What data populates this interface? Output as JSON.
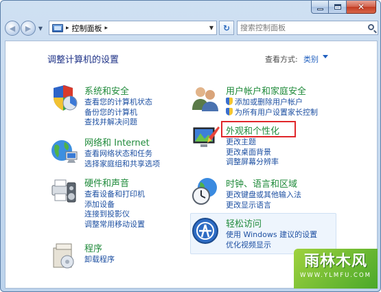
{
  "window": {
    "caption": {
      "minimize": "—",
      "maximize": "□",
      "close": "✕"
    }
  },
  "nav": {
    "back_icon": "back-arrow-icon",
    "forward_icon": "forward-arrow-icon",
    "address": {
      "separator": "▸",
      "location": "控制面板",
      "trail_separator": "▸"
    },
    "refresh_icon": "refresh-icon",
    "search": {
      "placeholder": "搜索控制面板"
    }
  },
  "page": {
    "title": "调整计算机的设置",
    "view_by_label": "查看方式:",
    "view_by_value": "类别"
  },
  "categories": {
    "system": {
      "title": "系统和安全",
      "links": [
        "查看您的计算机状态",
        "备份您的计算机",
        "查找并解决问题"
      ]
    },
    "network": {
      "title": "网络和 Internet",
      "links": [
        "查看网络状态和任务",
        "选择家庭组和共享选项"
      ]
    },
    "hardware": {
      "title": "硬件和声音",
      "links": [
        "查看设备和打印机",
        "添加设备",
        "连接到投影仪",
        "调整常用移动设置"
      ]
    },
    "programs": {
      "title": "程序",
      "links": [
        "卸载程序"
      ]
    },
    "users": {
      "title": "用户帐户和家庭安全",
      "links": [
        "添加或删除用户帐户",
        "为所有用户设置家长控制"
      ]
    },
    "appearance": {
      "title": "外观和个性化",
      "links": [
        "更改主题",
        "更改桌面背景",
        "调整屏幕分辨率"
      ]
    },
    "clock": {
      "title": "时钟、语言和区域",
      "links": [
        "更改键盘或其他输入法",
        "更改显示语言"
      ]
    },
    "ease": {
      "title": "轻松访问",
      "links": [
        "使用 Windows 建议的设置",
        "优化视频显示"
      ]
    }
  },
  "watermark": {
    "text": "雨林木风",
    "url": "WWW.YLMFU.COM"
  },
  "colors": {
    "category_title": "#1f8a3a",
    "link": "#1e50a2",
    "highlight": "#e0262a",
    "watermark": "#4aa82a"
  }
}
